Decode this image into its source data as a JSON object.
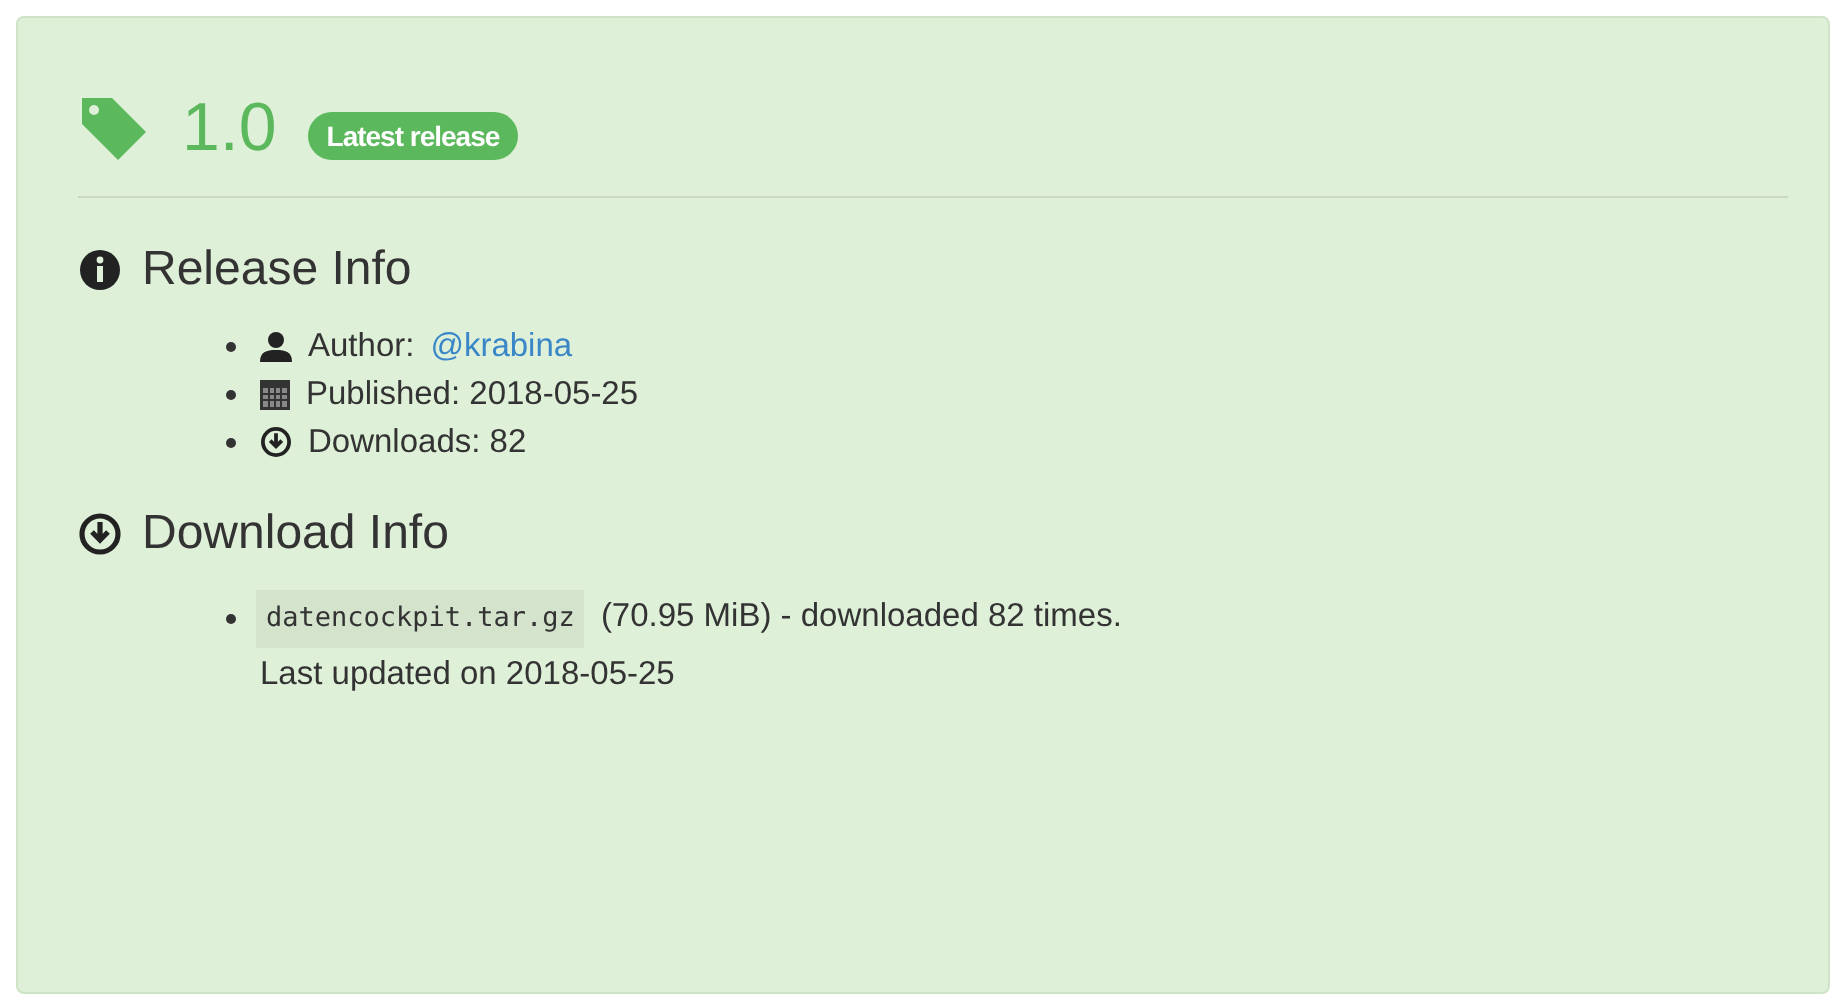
{
  "release": {
    "version": "1.0",
    "badge": "Latest release"
  },
  "release_info": {
    "title": "Release Info",
    "items": [
      {
        "kind": "author",
        "label": "Author:",
        "link": "@krabina"
      },
      {
        "kind": "published",
        "label": "Published: 2018-05-25"
      },
      {
        "kind": "downloads",
        "label": "Downloads: 82"
      }
    ]
  },
  "download_info": {
    "title": "Download Info",
    "files": [
      {
        "name": "datencockpit.tar.gz",
        "details": "(70.95 MiB) - downloaded 82 times.",
        "updated": "Last updated on 2018-05-25"
      }
    ]
  }
}
